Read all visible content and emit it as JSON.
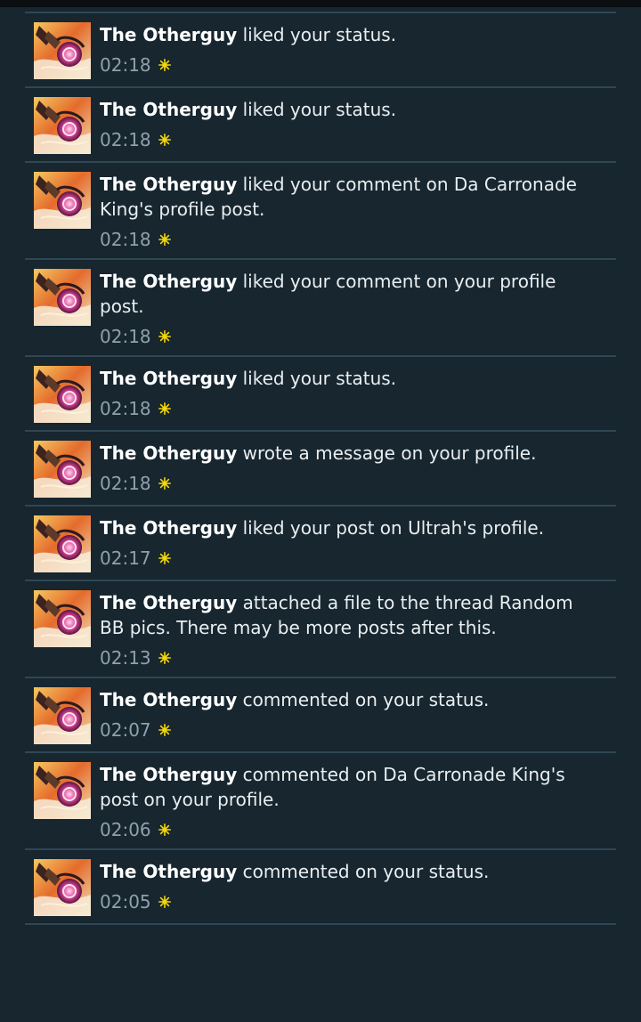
{
  "notifications": [
    {
      "user": "The Otherguy",
      "action": " liked your status.",
      "time": "02:18",
      "avatar": "avatar-image",
      "status_icon": "new-star-icon"
    },
    {
      "user": "The Otherguy",
      "action": " liked your status.",
      "time": "02:18",
      "avatar": "avatar-image",
      "status_icon": "new-star-icon"
    },
    {
      "user": "The Otherguy",
      "action": " liked your comment on Da Carronade King's profile post.",
      "time": "02:18",
      "avatar": "avatar-image",
      "status_icon": "new-star-icon"
    },
    {
      "user": "The Otherguy",
      "action": " liked your comment on your profile post.",
      "time": "02:18",
      "avatar": "avatar-image",
      "status_icon": "new-star-icon"
    },
    {
      "user": "The Otherguy",
      "action": " liked your status.",
      "time": "02:18",
      "avatar": "avatar-image",
      "status_icon": "new-star-icon"
    },
    {
      "user": "The Otherguy",
      "action": " wrote a message on your profile.",
      "time": "02:18",
      "avatar": "avatar-image",
      "status_icon": "new-star-icon"
    },
    {
      "user": "The Otherguy",
      "action": " liked your post on Ultrah's profile.",
      "time": "02:17",
      "avatar": "avatar-image",
      "status_icon": "new-star-icon"
    },
    {
      "user": "The Otherguy",
      "action": " attached a file to the thread Random BB pics. There may be more posts after this.",
      "time": "02:13",
      "avatar": "avatar-image",
      "status_icon": "new-star-icon"
    },
    {
      "user": "The Otherguy",
      "action": " commented on your status.",
      "time": "02:07",
      "avatar": "avatar-image",
      "status_icon": "new-star-icon"
    },
    {
      "user": "The Otherguy",
      "action": " commented on Da Carronade King's post on your profile.",
      "time": "02:06",
      "avatar": "avatar-image",
      "status_icon": "new-star-icon"
    },
    {
      "user": "The Otherguy",
      "action": " commented on your status.",
      "time": "02:05",
      "avatar": "avatar-image",
      "status_icon": "new-star-icon"
    }
  ],
  "colors": {
    "background": "#17262f",
    "divider": "#2f4754",
    "text": "#e9eef1",
    "time": "#8fa2ac",
    "star": "#f2d60d"
  }
}
